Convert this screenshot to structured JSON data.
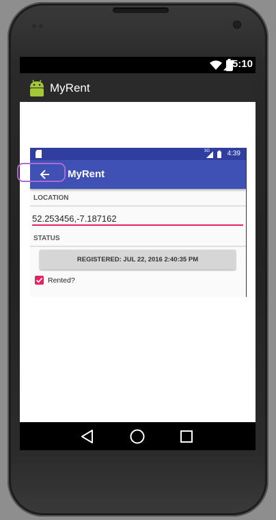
{
  "device": {
    "status_time": "5:10",
    "app_title": "MyRent",
    "nav_buttons": [
      "back-icon",
      "home-icon",
      "recents-icon"
    ]
  },
  "inner_app": {
    "status_time": "4:39",
    "status_network": "3G",
    "title": "MyRent",
    "back_icon": "arrow-back-icon",
    "location_header": "LOCATION",
    "location_value": "52.253456,-7.187162",
    "status_header": "STATUS",
    "registered_button": "REGISTERED: JUL 22, 2016 2:40:35 PM",
    "rented_label": "Rented?",
    "rented_checked": true
  },
  "colors": {
    "primary": "#3f51b5",
    "primary_dark": "#303f9f",
    "accent": "#e91e63",
    "highlight": "#b06ad6"
  }
}
